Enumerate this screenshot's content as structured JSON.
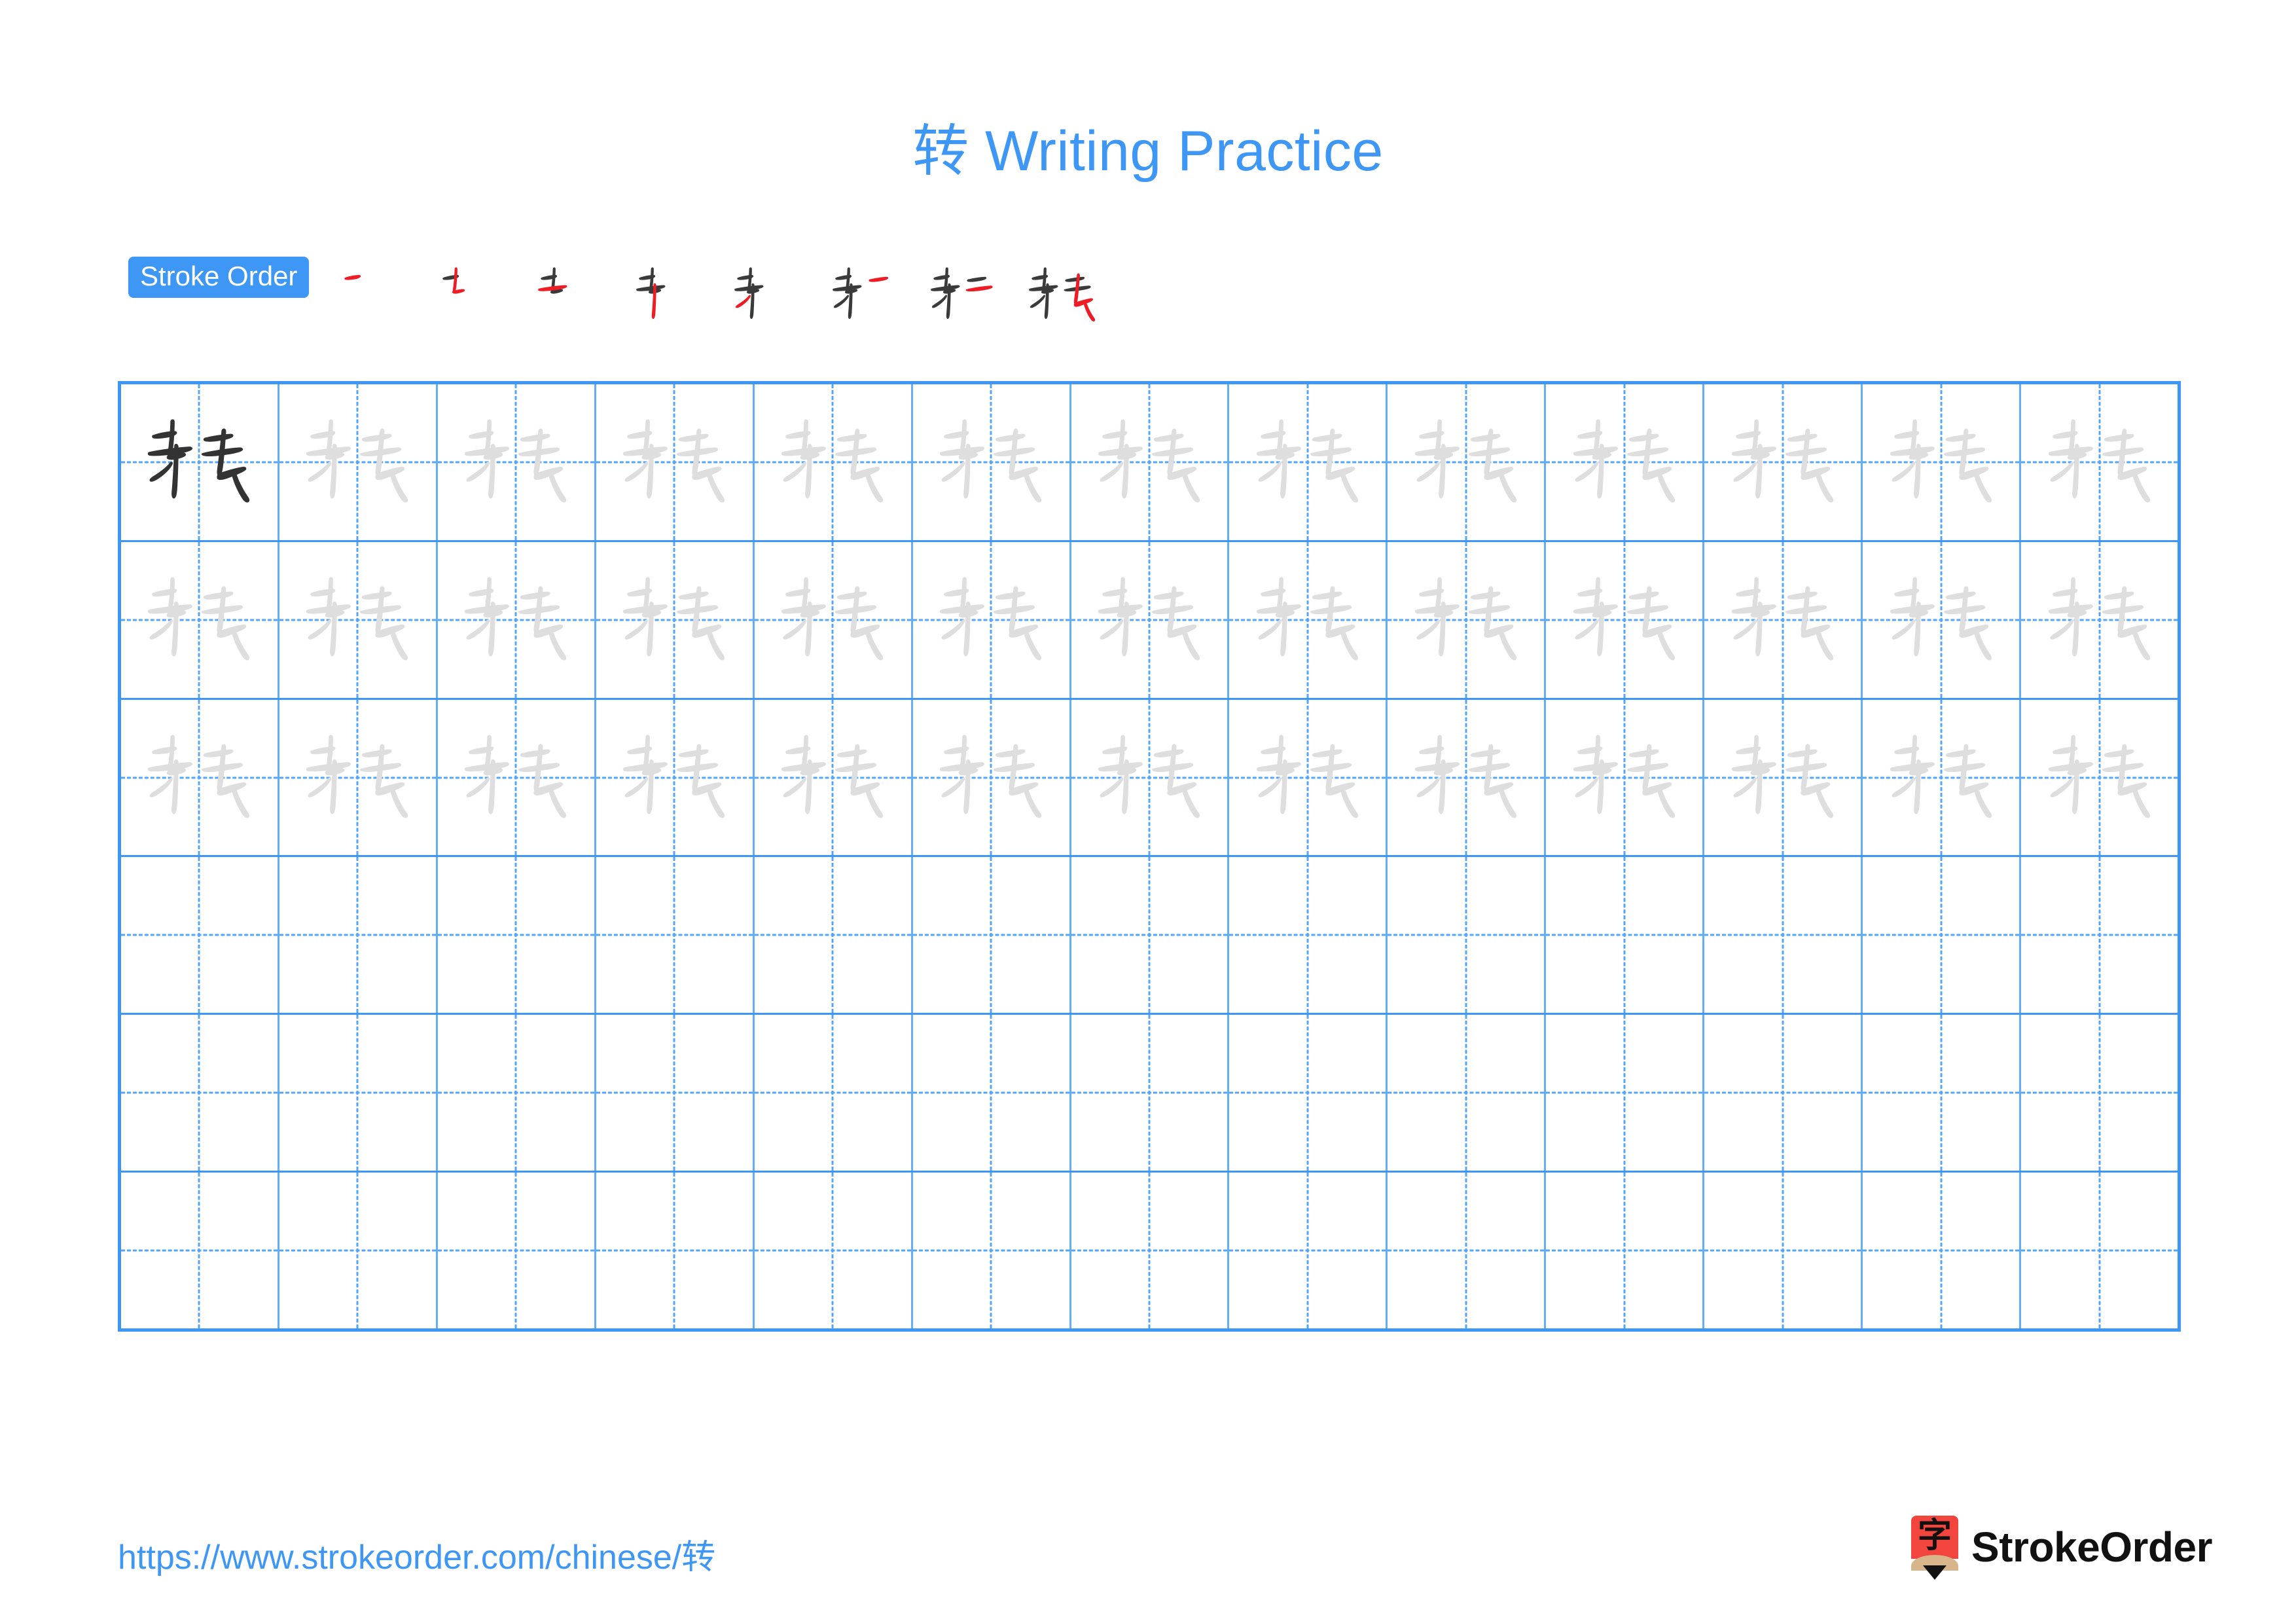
{
  "page": {
    "character": "转",
    "title": "转 Writing Practice",
    "title_prefix": "转",
    "title_suffix": " Writing Practice",
    "accent_color": "#3f97f5",
    "grid_line_color": "#64aef8",
    "guide_line_color": "#55a6f7",
    "trace_char_color": "#dedede",
    "model_char_color": "#333333",
    "stroke_new_color": "#ee1c25",
    "stroke_done_color": "#3a3a3a"
  },
  "stroke_order": {
    "badge_label": "Stroke Order",
    "stroke_count": 8,
    "steps": [
      {
        "index": 1,
        "strokes_shown": 1,
        "new_stroke": 1
      },
      {
        "index": 2,
        "strokes_shown": 2,
        "new_stroke": 2
      },
      {
        "index": 3,
        "strokes_shown": 3,
        "new_stroke": 3
      },
      {
        "index": 4,
        "strokes_shown": 4,
        "new_stroke": 4
      },
      {
        "index": 5,
        "strokes_shown": 5,
        "new_stroke": 5
      },
      {
        "index": 6,
        "strokes_shown": 6,
        "new_stroke": 6
      },
      {
        "index": 7,
        "strokes_shown": 7,
        "new_stroke": 7
      },
      {
        "index": 8,
        "strokes_shown": 8,
        "new_stroke": 8
      }
    ]
  },
  "grid": {
    "columns": 13,
    "rows": 6,
    "cells": [
      [
        "model",
        "trace",
        "trace",
        "trace",
        "trace",
        "trace",
        "trace",
        "trace",
        "trace",
        "trace",
        "trace",
        "trace",
        "trace"
      ],
      [
        "trace",
        "trace",
        "trace",
        "trace",
        "trace",
        "trace",
        "trace",
        "trace",
        "trace",
        "trace",
        "trace",
        "trace",
        "trace"
      ],
      [
        "trace",
        "trace",
        "trace",
        "trace",
        "trace",
        "trace",
        "trace",
        "trace",
        "trace",
        "trace",
        "trace",
        "trace",
        "trace"
      ],
      [
        "empty",
        "empty",
        "empty",
        "empty",
        "empty",
        "empty",
        "empty",
        "empty",
        "empty",
        "empty",
        "empty",
        "empty",
        "empty"
      ],
      [
        "empty",
        "empty",
        "empty",
        "empty",
        "empty",
        "empty",
        "empty",
        "empty",
        "empty",
        "empty",
        "empty",
        "empty",
        "empty"
      ],
      [
        "empty",
        "empty",
        "empty",
        "empty",
        "empty",
        "empty",
        "empty",
        "empty",
        "empty",
        "empty",
        "empty",
        "empty",
        "empty"
      ]
    ]
  },
  "footer": {
    "url": "https://www.strokeorder.com/chinese/转",
    "url_prefix": "https://www.strokeorder.com/chinese/",
    "url_char": "转",
    "brand_name": "StrokeOrder",
    "brand_mark_glyph": "字",
    "brand_mark_color": "#f2453d",
    "brand_wood_color": "#d9b58c"
  }
}
